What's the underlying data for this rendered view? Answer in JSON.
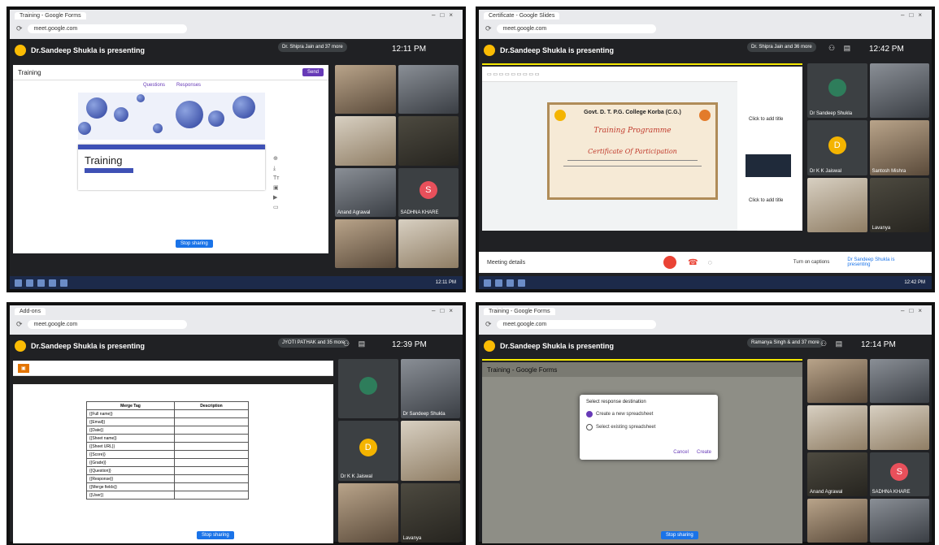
{
  "panels": [
    {
      "id": "top-left",
      "browser": {
        "tab": "Training - Google Forms",
        "url": "meet.google.com"
      },
      "presenter_text": "Dr.Sandeep Shukla is presenting",
      "pinned": "Dr. Shipra Jain and 37 more",
      "time": "12:11 PM",
      "form": {
        "title": "Training",
        "tabs": [
          "Questions",
          "Responses"
        ],
        "send": "Send",
        "bottom_button": "Stop sharing"
      },
      "tiles": [
        {
          "name": ""
        },
        {
          "name": ""
        },
        {
          "name": ""
        },
        {
          "name": ""
        },
        {
          "name": "Anand Agrawal"
        },
        {
          "name": "SADHNA KHARE",
          "initial": "S"
        },
        {
          "name": ""
        },
        {
          "name": ""
        }
      ],
      "taskbar_time": "12:11 PM"
    },
    {
      "id": "top-right",
      "browser": {
        "tab": "Certificate - Google Slides",
        "url": "meet.google.com"
      },
      "presenter_text": "Dr.Sandeep Shukla is presenting",
      "pinned": "Dr. Shipra Jain and 36 more",
      "time": "12:42 PM",
      "certificate": {
        "college": "Govt. D. T. P.G. College Korba (C.G.)",
        "program": "Training Programme",
        "heading": "Certificate Of Participation"
      },
      "side_buttons": [
        "Click to add title",
        "Click to add title"
      ],
      "tiles": [
        {
          "name": "Dr Sandeep Shukla"
        },
        {
          "name": ""
        },
        {
          "name": "Dr K K Jaiswal",
          "initial": "D"
        },
        {
          "name": "Santosh Mishra"
        },
        {
          "name": ""
        },
        {
          "name": "Lavanya"
        }
      ],
      "bottom": {
        "meeting_details": "Meeting details",
        "captions": "Turn on captions",
        "presenting": "Dr Sandeep Shukla is presenting"
      },
      "taskbar_time": "12:42 PM"
    },
    {
      "id": "bottom-left",
      "browser": {
        "tab": "Add-ons",
        "url": "meet.google.com"
      },
      "presenter_text": "Dr.Sandeep Shukla is presenting",
      "pinned": "JYOTI PATHAK and 35 more",
      "time": "12:39 PM",
      "addon_table": {
        "header": [
          "Merge Tag",
          "Description"
        ],
        "rows": [
          [
            "{{Full name}}",
            ""
          ],
          [
            "{{Email}}",
            ""
          ],
          [
            "{{Date}}",
            ""
          ],
          [
            "{{Sheet name}}",
            ""
          ],
          [
            "{{Sheet URL}}",
            ""
          ],
          [
            "{{Score}}",
            ""
          ],
          [
            "{{Grade}}",
            ""
          ],
          [
            "{{Question}}",
            ""
          ],
          [
            "{{Response}}",
            ""
          ],
          [
            "{{Merge fields}}",
            ""
          ],
          [
            "{{User}}",
            ""
          ]
        ]
      },
      "tiles": [
        {
          "name": ""
        },
        {
          "name": "Dr Sandeep Shukla"
        },
        {
          "name": "Dr K K Jaiswal",
          "initial": "D"
        },
        {
          "name": ""
        },
        {
          "name": ""
        },
        {
          "name": "Lavanya"
        }
      ],
      "bottom_button": "Stop sharing"
    },
    {
      "id": "bottom-right",
      "browser": {
        "tab": "Training - Google Forms",
        "url": "meet.google.com"
      },
      "presenter_text": "Dr.Sandeep Shukla is presenting",
      "pinned": "Ramanya Singh & and 37 more",
      "time": "12:14 PM",
      "modal": {
        "title": "Select response destination",
        "option1": "Create a new spreadsheet",
        "option2": "Select existing spreadsheet",
        "cancel": "Cancel",
        "create": "Create"
      },
      "tiles": [
        {
          "name": ""
        },
        {
          "name": ""
        },
        {
          "name": ""
        },
        {
          "name": ""
        },
        {
          "name": "Anand Agrawal"
        },
        {
          "name": "SADHNA KHARE",
          "initial": "S"
        },
        {
          "name": ""
        },
        {
          "name": ""
        }
      ],
      "bottom_button": "Stop sharing"
    }
  ],
  "colors": {
    "meet_bg": "#202124",
    "accent_blue": "#1a73e8",
    "forms_purple": "#673ab7",
    "avatar_red": "#e8505b",
    "avatar_yellow": "#f4b400",
    "presenting_yellow": "#f5e800"
  }
}
